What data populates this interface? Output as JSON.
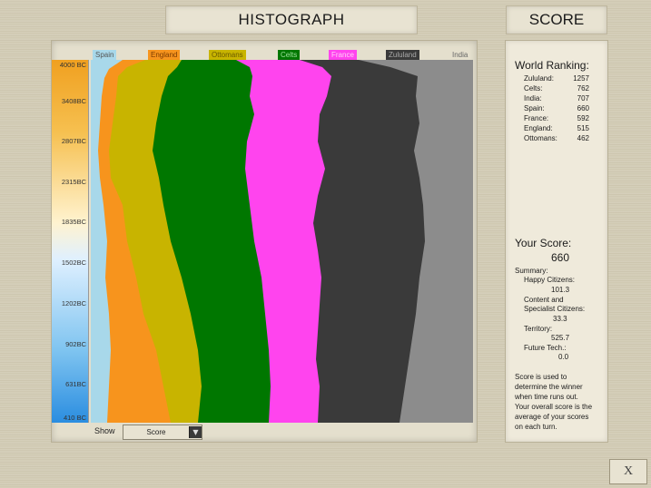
{
  "header": {
    "title": "HISTOGRAPH",
    "score_title": "SCORE"
  },
  "timeline": {
    "ticks": [
      "4000 BC",
      "3408BC",
      "2807BC",
      "2315BC",
      "1835BC",
      "1502BC",
      "1202BC",
      "902BC",
      "631BC",
      "410 BC"
    ]
  },
  "civs": [
    {
      "name": "Spain",
      "color": "#a8d8ea"
    },
    {
      "name": "England",
      "color": "#f7941d"
    },
    {
      "name": "Ottomans",
      "color": "#c8b400"
    },
    {
      "name": "Celts",
      "color": "#007700"
    },
    {
      "name": "France",
      "color": "#ff44ee"
    },
    {
      "name": "Zululand",
      "color": "#3a3a3a"
    },
    {
      "name": "India",
      "color": "#8c8c8c"
    }
  ],
  "controls": {
    "show_label": "Show",
    "show_value": "Score",
    "dropdown_icon": "chevron-down-icon"
  },
  "ranking": {
    "title": "World Ranking:",
    "rows": [
      {
        "name": "Zululand:",
        "value": "1257"
      },
      {
        "name": "Celts:",
        "value": "762"
      },
      {
        "name": "India:",
        "value": "707"
      },
      {
        "name": "Spain:",
        "value": "660"
      },
      {
        "name": "France:",
        "value": "592"
      },
      {
        "name": "England:",
        "value": "515"
      },
      {
        "name": "Ottomans:",
        "value": "462"
      }
    ]
  },
  "your_score": {
    "title": "Your Score:",
    "value": "660",
    "summary_label": "Summary:",
    "happy_label": "Happy Citizens:",
    "happy_value": "101.3",
    "content_label_1": "Content and",
    "content_label_2": "Specialist Citizens:",
    "content_value": "33.3",
    "territory_label": "Territory:",
    "territory_value": "525.7",
    "future_label": "Future Tech.:",
    "future_value": "0.0",
    "note_lines": [
      "Score is used to",
      "determine the winner",
      "when time runs out.",
      "Your overall score is the",
      "average of your scores",
      "on each turn."
    ]
  },
  "close_button": {
    "label": "X"
  }
}
